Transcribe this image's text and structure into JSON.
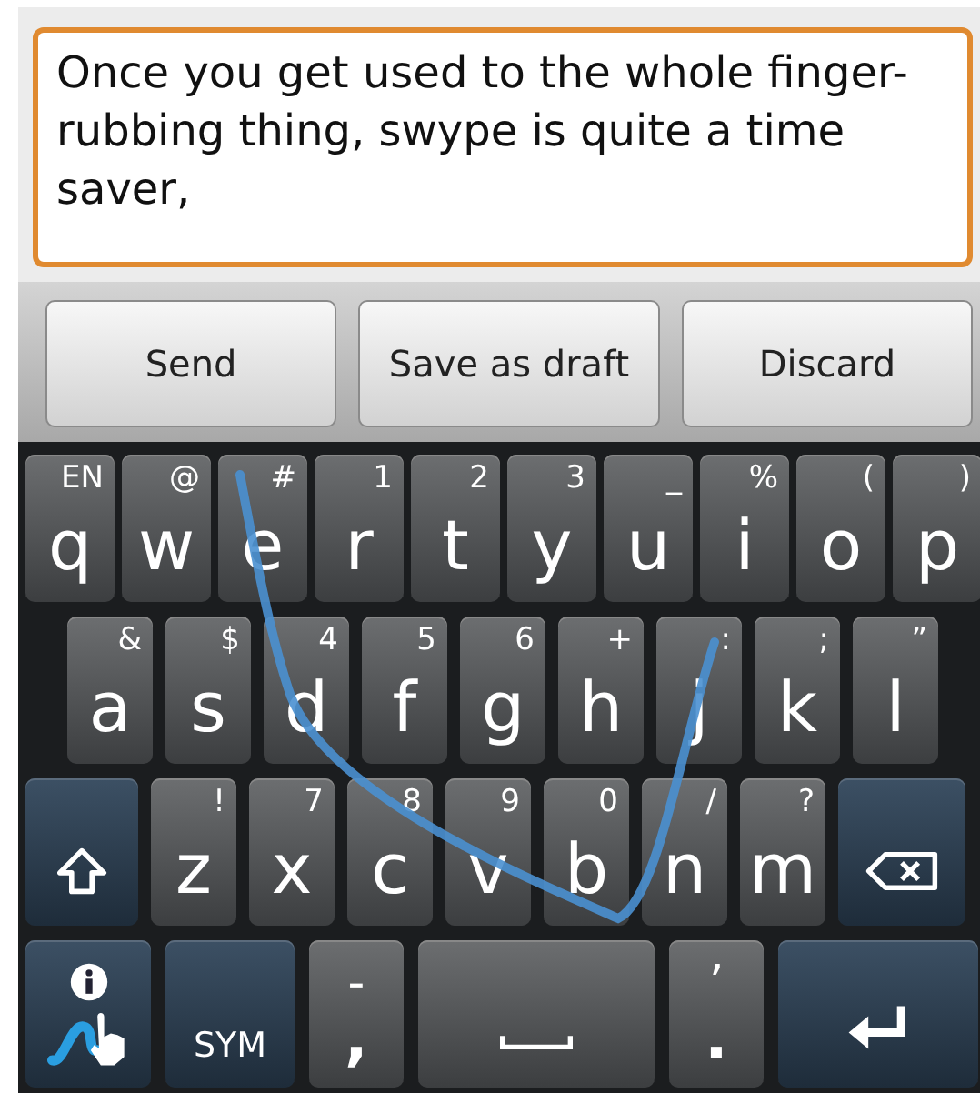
{
  "compose": {
    "value": "Once you get used to the whole finger-rubbing thing, swype is quite a time saver,"
  },
  "buttons": [
    "Send",
    "Save as draft",
    "Discard"
  ],
  "keyboard": {
    "rows": [
      {
        "keys": [
          {
            "kind": "letter",
            "label": "q",
            "hint": "EN"
          },
          {
            "kind": "letter",
            "label": "w",
            "hint": "@"
          },
          {
            "kind": "letter",
            "label": "e",
            "hint": "#"
          },
          {
            "kind": "letter",
            "label": "r",
            "hint": "1"
          },
          {
            "kind": "letter",
            "label": "t",
            "hint": "2"
          },
          {
            "kind": "letter",
            "label": "y",
            "hint": "3"
          },
          {
            "kind": "letter",
            "label": "u",
            "hint": "_"
          },
          {
            "kind": "letter",
            "label": "i",
            "hint": "%"
          },
          {
            "kind": "letter",
            "label": "o",
            "hint": "("
          },
          {
            "kind": "letter",
            "label": "p",
            "hint": ")"
          }
        ]
      },
      {
        "keys": [
          {
            "kind": "letter",
            "label": "a",
            "hint": "&"
          },
          {
            "kind": "letter",
            "label": "s",
            "hint": "$"
          },
          {
            "kind": "letter",
            "label": "d",
            "hint": "4"
          },
          {
            "kind": "letter",
            "label": "f",
            "hint": "5"
          },
          {
            "kind": "letter",
            "label": "g",
            "hint": "6"
          },
          {
            "kind": "letter",
            "label": "h",
            "hint": "+"
          },
          {
            "kind": "letter",
            "label": "j",
            "hint": ":"
          },
          {
            "kind": "letter",
            "label": "k",
            "hint": ";"
          },
          {
            "kind": "letter",
            "label": "l",
            "hint": "”"
          }
        ]
      },
      {
        "keys": [
          {
            "kind": "shift"
          },
          {
            "kind": "letter",
            "label": "z",
            "hint": "!"
          },
          {
            "kind": "letter",
            "label": "x",
            "hint": "7"
          },
          {
            "kind": "letter",
            "label": "c",
            "hint": "8"
          },
          {
            "kind": "letter",
            "label": "v",
            "hint": "9"
          },
          {
            "kind": "letter",
            "label": "b",
            "hint": "0"
          },
          {
            "kind": "letter",
            "label": "n",
            "hint": "/"
          },
          {
            "kind": "letter",
            "label": "m",
            "hint": "?"
          },
          {
            "kind": "backspace"
          }
        ]
      },
      {
        "keys": [
          {
            "kind": "swype"
          },
          {
            "kind": "sym",
            "label": "SYM"
          },
          {
            "kind": "punct",
            "label": ",",
            "hint": "-"
          },
          {
            "kind": "space"
          },
          {
            "kind": "punct",
            "label": ".",
            "hint": "’"
          },
          {
            "kind": "enter"
          }
        ]
      }
    ]
  }
}
